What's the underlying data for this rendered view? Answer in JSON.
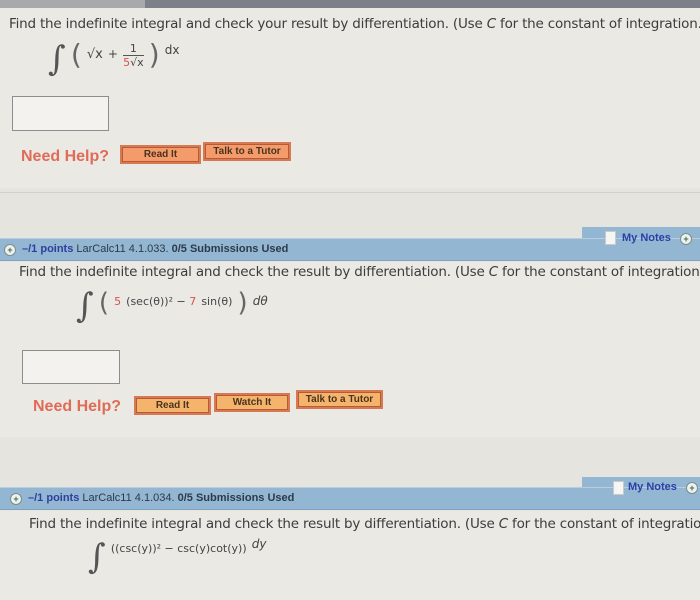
{
  "questions": [
    {
      "prompt_pre": "Find the indefinite integral and check your result by differentiation. (Use ",
      "prompt_var": "C",
      "prompt_post": " for the constant of integration.)",
      "integrand": {
        "open": "(",
        "term1": "√x",
        "plus": "+",
        "frac_num": "1",
        "frac_den_coef": "5",
        "frac_den_rest": "√x",
        "close": ")",
        "differential": "dx"
      },
      "answer_value": "",
      "help_label": "Need Help?",
      "buttons": [
        "Read It",
        "Talk to a Tutor"
      ]
    },
    {
      "header": {
        "points": "–/1 points",
        "problem_id": "LarCalc11 4.1.033.",
        "submissions": "0/5 Submissions Used",
        "notes_label": "My Notes"
      },
      "prompt_pre": "Find the indefinite integral and check the result by differentiation. (Use ",
      "prompt_var": "C",
      "prompt_post": " for the constant of integration.)",
      "integrand": {
        "coef1": "5",
        "term1": " (sec(θ))² − ",
        "coef2": "7",
        "term2": " sin(θ)",
        "differential": "dθ"
      },
      "answer_value": "",
      "help_label": "Need Help?",
      "buttons": [
        "Read It",
        "Watch It",
        "Talk to a Tutor"
      ]
    },
    {
      "header": {
        "points": "–/1 points",
        "problem_id": "LarCalc11 4.1.034.",
        "submissions": "0/5 Submissions Used",
        "notes_label": "My Notes"
      },
      "prompt_pre": "Find the indefinite integral and check the result by differentiation. (Use ",
      "prompt_var": "C",
      "prompt_post": " for the constant of integration.)",
      "integrand": {
        "expr": "((csc(y))² − csc(y)cot(y))",
        "differential": "dy"
      }
    }
  ],
  "colors": {
    "header_bar": "#93b6d2",
    "points_text": "#2f3f9e",
    "need_help": "#e06b57",
    "button_orange": "#f39b6a",
    "button_amber": "#f4b46b",
    "math_coefficient": "#d9534f"
  }
}
